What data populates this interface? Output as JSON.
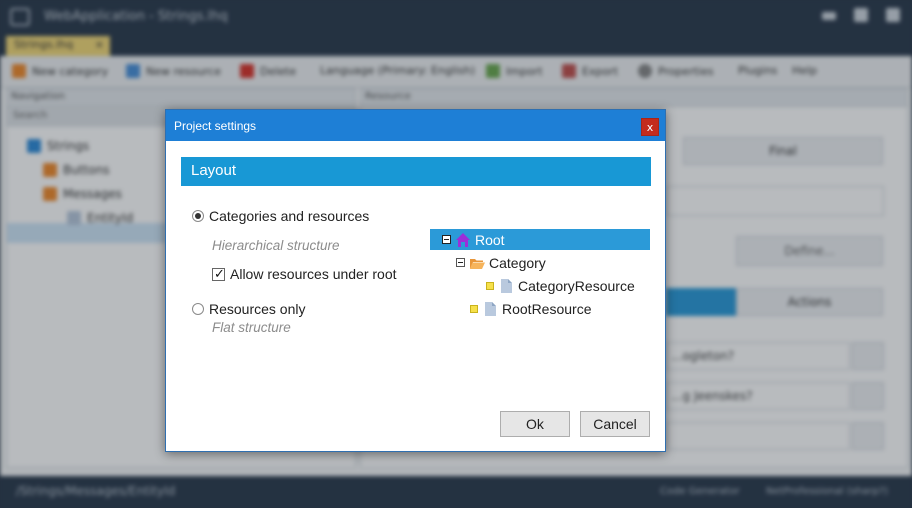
{
  "app": {
    "window_title": "WebApplication - Strings.lhq",
    "doc_tab": "Strings.lhq",
    "toolbar": {
      "new_category": "New category",
      "new_resource": "New resource",
      "delete": "Delete",
      "language": "Language (Primary: English)",
      "import": "Import",
      "export": "Export",
      "properties": "Properties",
      "plugins": "Plugins",
      "help": "Help"
    },
    "navigation": {
      "header": "Navigation",
      "search": "Search",
      "tree": [
        "Strings",
        "Buttons",
        "Messages",
        "EntityId"
      ]
    },
    "resource": {
      "header": "Resource",
      "state": "Final",
      "define": "Define...",
      "actions": "Actions",
      "q1": "...ogleton?",
      "q2": "...g Jeenskes?"
    },
    "status": {
      "path": "/Strings/Messages/EntityId",
      "code_gen": "Code Generator",
      "template": "NetProfessional (sharp?)"
    }
  },
  "dialog": {
    "title": "Project settings",
    "close_glyph": "x",
    "section": "Layout",
    "opt_hierarchical": {
      "label": "Categories and resources",
      "hint": "Hierarchical structure",
      "selected": true
    },
    "allow_resources": {
      "label": "Allow resources under root",
      "checked": true,
      "mark": "✓"
    },
    "opt_flat": {
      "label": "Resources only",
      "hint": "Flat structure",
      "selected": false
    },
    "tree": {
      "root": "Root",
      "category": "Category",
      "category_resource": "CategoryResource",
      "root_resource": "RootResource"
    },
    "ok": "Ok",
    "cancel": "Cancel"
  },
  "colors": {
    "title_bar": "#1e7fd6",
    "section_header": "#1898d5",
    "tree_selection": "#2b9ad8",
    "close_button": "#c42b1c"
  }
}
